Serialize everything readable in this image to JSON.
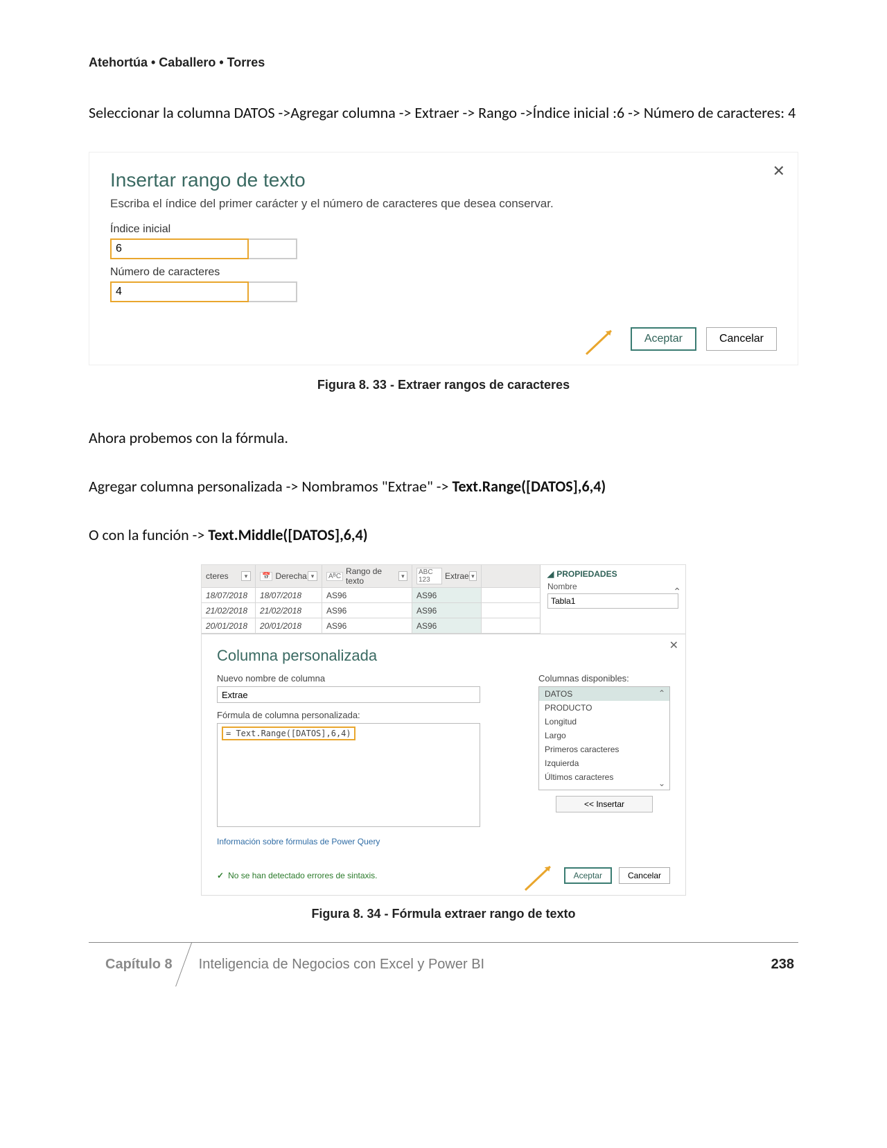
{
  "header_authors": "Atehortúa • Caballero • Torres",
  "para1": "Seleccionar la columna DATOS ->Agregar columna -> Extraer -> Rango ->Índice inicial :6 -> Número de caracteres: 4",
  "dlg1": {
    "title": "Insertar rango de texto",
    "subtitle": "Escriba el índice del primer carácter y el número de caracteres que desea conservar.",
    "lbl_start": "Índice inicial",
    "val_start": "6",
    "lbl_len": "Número de caracteres",
    "val_len": "4",
    "accept": "Aceptar",
    "cancel": "Cancelar"
  },
  "fig1_caption": "Figura 8. 33 - Extraer rangos de caracteres",
  "para2": "Ahora probemos con la fórmula.",
  "para3_pre": "Agregar columna personalizada -> Nombramos \"Extrae\" -> ",
  "para3_bold": "Text.Range([DATOS],6,4)",
  "para4_pre": "O con la función -> ",
  "para4_bold": "Text.Middle([DATOS],6,4)",
  "tbl": {
    "hdr_cteres": "cteres",
    "hdr_derecha": "Derecha",
    "hdr_rango": "Rango de texto",
    "hdr_extrae": "Extrae",
    "type_abc": "AᴮC",
    "type_123": "ABC 123",
    "rows": [
      {
        "cteres": "18/07/2018",
        "derecha": "18/07/2018",
        "rango": "AS96",
        "extrae": "AS96"
      },
      {
        "cteres": "21/02/2018",
        "derecha": "21/02/2018",
        "rango": "AS96",
        "extrae": "AS96"
      },
      {
        "cteres": "20/01/2018",
        "derecha": "20/01/2018",
        "rango": "AS96",
        "extrae": "AS96"
      }
    ]
  },
  "side": {
    "props": "PROPIEDADES",
    "name_lbl": "Nombre",
    "name_val": "Tabla1"
  },
  "dlg2": {
    "title": "Columna personalizada",
    "name_lbl": "Nuevo nombre de columna",
    "name_val": "Extrae",
    "formula_lbl": "Fórmula de columna personalizada:",
    "formula_val": "= Text.Range([DATOS],6,4)",
    "cols_lbl": "Columnas disponibles:",
    "cols": [
      "DATOS",
      "PRODUCTO",
      "Longitud",
      "Largo",
      "Primeros caracteres",
      "Izquierda",
      "Últimos caracteres"
    ],
    "insert": "<< Insertar",
    "info": "Información sobre fórmulas de Power Query",
    "ok_msg": "No se han detectado errores de sintaxis.",
    "accept": "Aceptar",
    "cancel": "Cancelar"
  },
  "fig2_caption": "Figura 8. 34 - Fórmula extraer rango de texto",
  "footer": {
    "chapter": "Capítulo 8",
    "book": "Inteligencia de Negocios con Excel y Power BI",
    "page": "238"
  }
}
